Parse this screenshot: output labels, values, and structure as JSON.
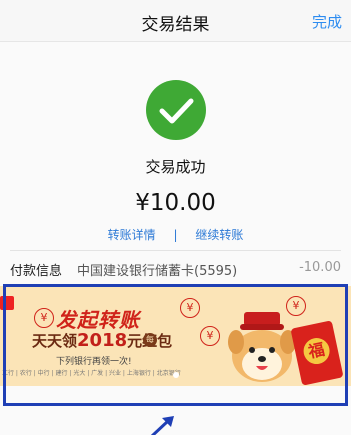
{
  "nav": {
    "title": "交易结果",
    "done_label": "完成"
  },
  "result": {
    "status_text": "交易成功",
    "amount": "¥10.00"
  },
  "links": {
    "detail_label": "转账详情",
    "separator": "|",
    "continue_label": "继续转账"
  },
  "payment": {
    "label": "付款信息",
    "card": "中国建设银行储蓄卡(5595)",
    "value": "-10.00"
  },
  "banner": {
    "title": "发起转账",
    "sub_prefix": "天天领",
    "sub_year": "2018",
    "sub_suffix": "元红包",
    "badge": "每日",
    "note": "下列银行再领一次!",
    "banks": "工行 | 农行 | 中行 | 建行 | 光大 | 广发 | 兴业 | 上海银行 | 北京银行",
    "envelope_char": "福",
    "yen_symbol": "¥"
  },
  "colors": {
    "accent": "#2d8cf0",
    "success": "#3fa935",
    "highlight": "#1f3fb5",
    "banner_bg": "#fbe4b7",
    "banner_red": "#d0231a"
  }
}
